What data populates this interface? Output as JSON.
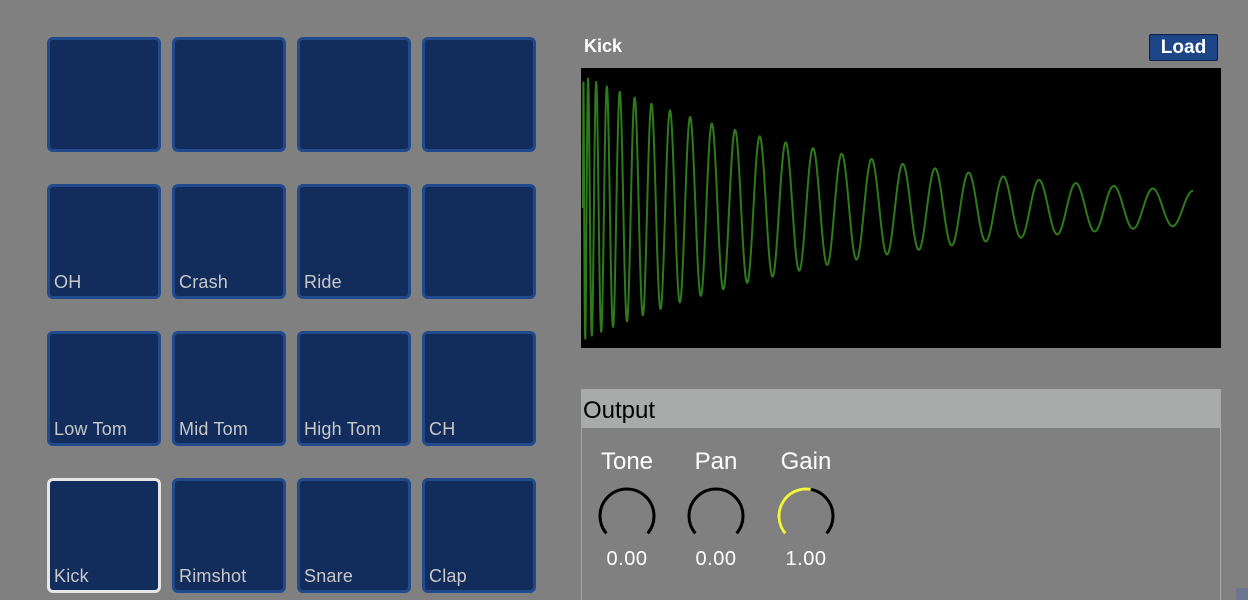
{
  "pads": {
    "rows": [
      [
        {
          "label": ""
        },
        {
          "label": ""
        },
        {
          "label": ""
        },
        {
          "label": ""
        }
      ],
      [
        {
          "label": "OH"
        },
        {
          "label": "Crash"
        },
        {
          "label": "Ride"
        },
        {
          "label": ""
        }
      ],
      [
        {
          "label": "Low Tom"
        },
        {
          "label": "Mid Tom"
        },
        {
          "label": "High Tom"
        },
        {
          "label": "CH"
        }
      ],
      [
        {
          "label": "Kick"
        },
        {
          "label": "Rimshot"
        },
        {
          "label": "Snare"
        },
        {
          "label": "Clap"
        }
      ]
    ],
    "selected": "Kick"
  },
  "sample": {
    "name": "Kick",
    "load_label": "Load"
  },
  "output": {
    "title": "Output",
    "knobs": [
      {
        "label": "Tone",
        "value": "0.00",
        "level": 0.0
      },
      {
        "label": "Pan",
        "value": "0.00",
        "level": 0.0
      },
      {
        "label": "Gain",
        "value": "1.00",
        "level": 1.0
      }
    ]
  },
  "colors": {
    "background": "#808080",
    "pad": "#122d5c",
    "pad_border": "#214a8c",
    "pad_selected_border": "#e6e6e6",
    "waveform": "#2f7a1c",
    "knob_ring": "#000000",
    "knob_active": "#f5f542"
  }
}
